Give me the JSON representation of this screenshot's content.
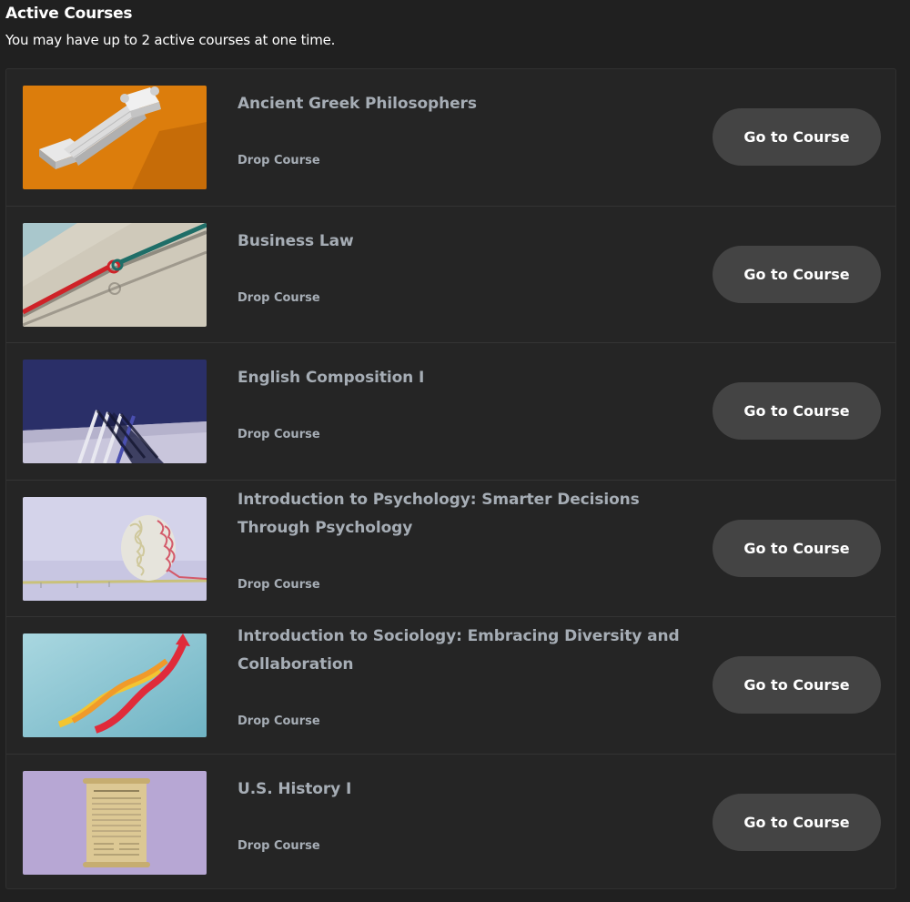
{
  "header": {
    "title": "Active Courses",
    "subtitle": "You may have up to 2 active courses at one time."
  },
  "courses": [
    {
      "title": "Ancient Greek Philosophers",
      "drop_label": "Drop Course",
      "button_label": "Go to Course",
      "thumbnail": "greek-column-image"
    },
    {
      "title": "Business Law",
      "drop_label": "Drop Course",
      "button_label": "Go to Course",
      "thumbnail": "knotted-ropes-image"
    },
    {
      "title": "English Composition I",
      "drop_label": "Drop Course",
      "button_label": "Go to Course",
      "thumbnail": "leaning-rods-image"
    },
    {
      "title": "Introduction to Psychology: Smarter Decisions Through Psychology",
      "drop_label": "Drop Course",
      "button_label": "Go to Course",
      "thumbnail": "brain-maze-image"
    },
    {
      "title": "Introduction to Sociology: Embracing Diversity and Collaboration",
      "drop_label": "Drop Course",
      "button_label": "Go to Course",
      "thumbnail": "rising-ribbons-image"
    },
    {
      "title": "U.S. History I",
      "drop_label": "Drop Course",
      "button_label": "Go to Course",
      "thumbnail": "declaration-scroll-image"
    }
  ],
  "colors": {
    "background": "#202020",
    "panel": "#252525",
    "muted_text": "#a6adb5",
    "button_bg": "#444444"
  }
}
